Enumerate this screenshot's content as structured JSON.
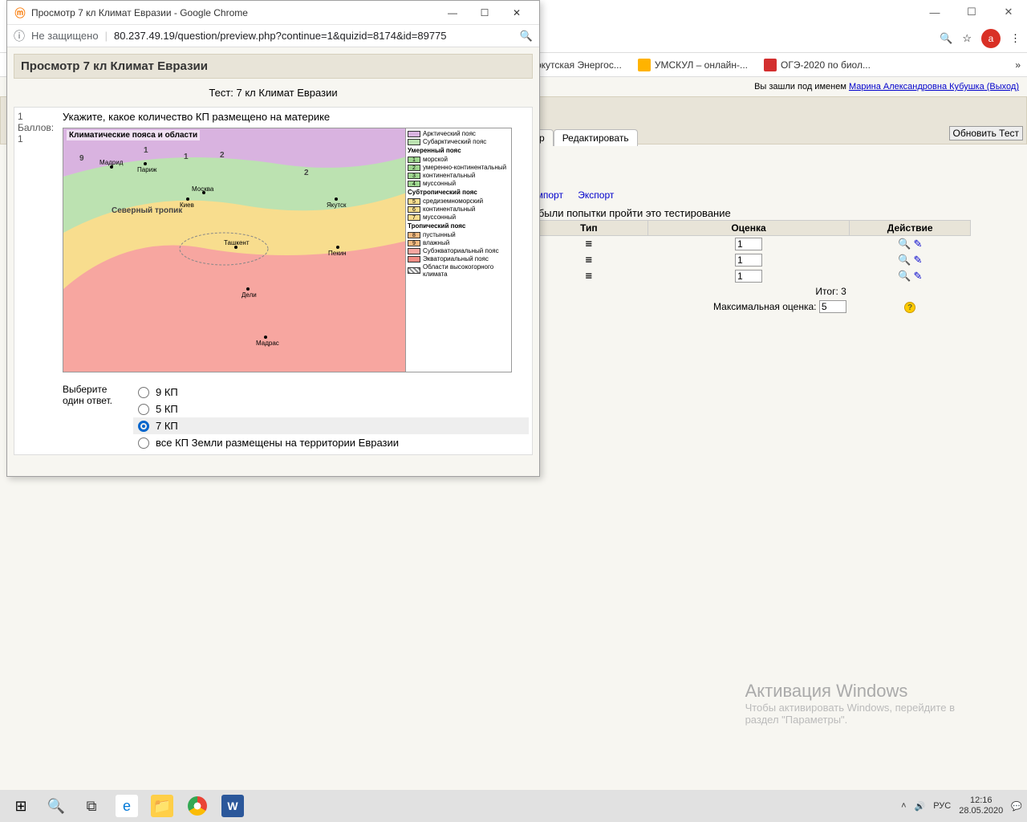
{
  "bg": {
    "titlebar_controls": [
      "—",
      "☐",
      "✕"
    ],
    "avatar_letter": "a",
    "bookmarks": [
      {
        "icon": "",
        "label": "ркутская Энергос..."
      },
      {
        "icon": "um",
        "label": "УМСКУЛ – онлайн-..."
      },
      {
        "icon": "red",
        "label": "ОГЭ-2020 по биол..."
      }
    ],
    "login_prefix": "Вы зашли под именем ",
    "login_name": "Марина Александровна Кубушка",
    "login_logout": " (Выход)",
    "update_btn": "Обновить Тест",
    "tabs": [
      "р",
      "Редактировать"
    ],
    "links": [
      "Импорт",
      "Экспорт"
    ],
    "attempts_text": "е были попытки пройти это тестирование",
    "table": {
      "headers": [
        "Тип",
        "Оценка",
        "Действие"
      ],
      "rows": [
        {
          "type": "☰",
          "val": "1"
        },
        {
          "type": "☰",
          "val": "1"
        },
        {
          "type": "☰",
          "val": "1"
        }
      ],
      "total_label": "Итог:",
      "total_val": "3",
      "max_label": "Максимальная оценка:",
      "max_val": "5"
    }
  },
  "popup": {
    "win_title": "Просмотр 7 кл Климат Евразии - Google Chrome",
    "secure_text": "Не защищено",
    "url": "80.237.49.19/question/preview.php?continue=1&quizid=8174&id=89775",
    "heading": "Просмотр 7 кл Климат Евразии",
    "test_label": "Тест: 7 кл Климат Евразии",
    "q_num": "1",
    "q_points_label": "Баллов:",
    "q_points": "1",
    "q_text": "Укажите, какое количество КП размещено на материке",
    "map_title": "Климатические пояса и области",
    "legend": {
      "arctic": "Арктический пояс",
      "subarctic": "Субарктический пояс",
      "temperate_h": "Умеренный пояс",
      "t1": "морской",
      "t2": "умеренно-континентальный",
      "t3": "континентальный",
      "t4": "муссонный",
      "subtrop_h": "Субтропический пояс",
      "s5": "средиземноморский",
      "s6": "континентальный",
      "s7": "муссонный",
      "trop_h": "Тропический пояс",
      "r8": "пустынный",
      "r9": "влажный",
      "subeq": "Субэкваториальный пояс",
      "eq": "Экваториальный пояс",
      "high": "Области высокогорного климата"
    },
    "cities": [
      "Мадрид",
      "Париж",
      "Москва",
      "Киев",
      "Якутск",
      "Ташкент",
      "Пекин",
      "Дели",
      "Мадрас"
    ],
    "ans_label": "Выберите один ответ.",
    "options": [
      "9 КП",
      "5 КП",
      "7 КП",
      "все КП Земли размещены на территории Евразии"
    ],
    "selected_index": 2
  },
  "watermark": {
    "title": "Активация Windows",
    "text1": "Чтобы активировать Windows, перейдите в",
    "text2": "раздел \"Параметры\"."
  },
  "taskbar": {
    "lang": "РУС",
    "time": "12:16",
    "date": "28.05.2020"
  }
}
